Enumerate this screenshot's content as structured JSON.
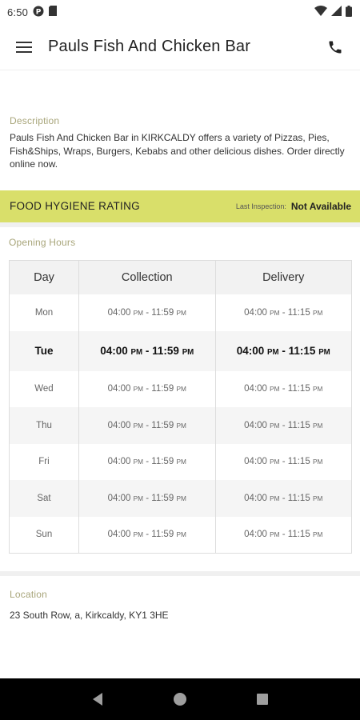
{
  "status_bar": {
    "time": "6:50",
    "icons": [
      "p-circle-icon",
      "sim-card-icon",
      "wifi-icon",
      "signal-icon",
      "battery-icon"
    ]
  },
  "app_bar": {
    "title": "Pauls Fish And Chicken Bar",
    "menu_icon": "hamburger-menu-icon",
    "phone_icon": "phone-icon"
  },
  "description": {
    "label": "Description",
    "text": "Pauls Fish And Chicken Bar in KIRKCALDY offers a variety of Pizzas, Pies, Fish&Ships, Wraps, Burgers, Kebabs and other delicious dishes. Order directly online now."
  },
  "hygiene": {
    "title": "FOOD HYGIENE RATING",
    "inspection_label": "Last Inspection:",
    "inspection_value": "Not Available",
    "color": "#d9df6a"
  },
  "opening_hours": {
    "label": "Opening Hours",
    "headers": [
      "Day",
      "Collection",
      "Delivery"
    ],
    "rows": [
      {
        "day": "Mon",
        "collection_start": "04:00",
        "collection_end": "11:59",
        "delivery_start": "04:00",
        "delivery_end": "11:15"
      },
      {
        "day": "Tue",
        "collection_start": "04:00",
        "collection_end": "11:59",
        "delivery_start": "04:00",
        "delivery_end": "11:15"
      },
      {
        "day": "Wed",
        "collection_start": "04:00",
        "collection_end": "11:59",
        "delivery_start": "04:00",
        "delivery_end": "11:15"
      },
      {
        "day": "Thu",
        "collection_start": "04:00",
        "collection_end": "11:59",
        "delivery_start": "04:00",
        "delivery_end": "11:15"
      },
      {
        "day": "Fri",
        "collection_start": "04:00",
        "collection_end": "11:59",
        "delivery_start": "04:00",
        "delivery_end": "11:15"
      },
      {
        "day": "Sat",
        "collection_start": "04:00",
        "collection_end": "11:59",
        "delivery_start": "04:00",
        "delivery_end": "11:15"
      },
      {
        "day": "Sun",
        "collection_start": "04:00",
        "collection_end": "11:59",
        "delivery_start": "04:00",
        "delivery_end": "11:15"
      }
    ],
    "pm": "PM",
    "dash": "-",
    "highlighted_day": "Tue"
  },
  "location": {
    "label": "Location",
    "address": "23 South Row, a, Kirkcaldy, KY1 3HE"
  },
  "nav_bar": {
    "icons": [
      "back-icon",
      "home-icon",
      "recents-icon"
    ]
  }
}
